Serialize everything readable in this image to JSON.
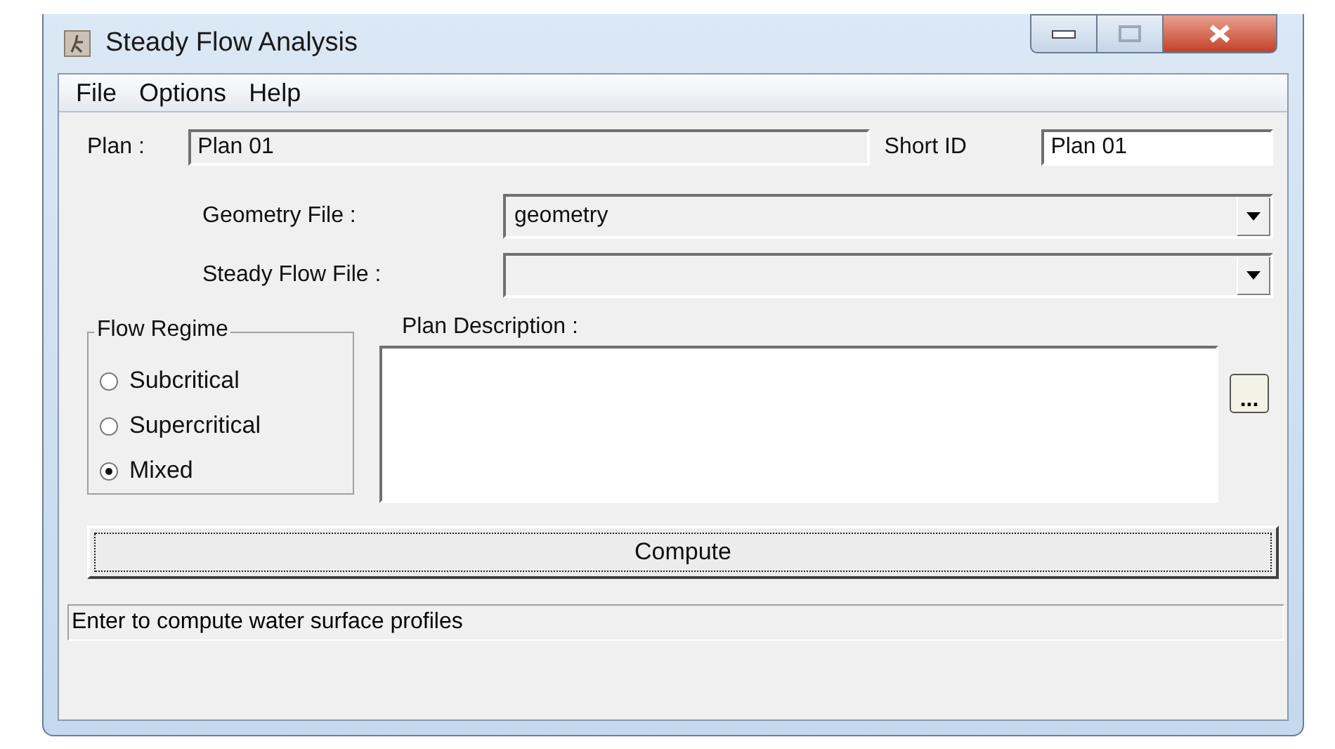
{
  "window": {
    "title": "Steady Flow Analysis"
  },
  "menu": [
    {
      "label": "File"
    },
    {
      "label": "Options"
    },
    {
      "label": "Help"
    }
  ],
  "plan": {
    "label": "Plan :",
    "value": "Plan 01",
    "disabled": true
  },
  "short_id": {
    "label": "Short ID",
    "value": "Plan 01",
    "disabled": false
  },
  "geometry_file": {
    "label": "Geometry File :",
    "value": "geometry"
  },
  "steady_flow_file": {
    "label": "Steady Flow File :"
  },
  "flow_regime": {
    "title": "Flow Regime",
    "options": [
      {
        "label": "Subcritical",
        "selected": false
      },
      {
        "label": "Supercritical",
        "selected": false
      },
      {
        "label": "Mixed",
        "selected": true
      }
    ]
  },
  "plan_description": {
    "label": "Plan Description :",
    "browse_button": "..."
  },
  "compute_button": "Compute",
  "status_bar": "Enter to compute water surface profiles"
}
